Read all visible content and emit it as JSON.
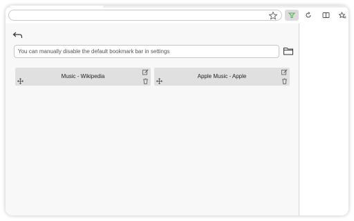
{
  "browser": {
    "address_value": "",
    "toolbar_icons": [
      "star-icon",
      "extension-icon",
      "refresh-icon",
      "split-screen-icon",
      "favorites-icon"
    ],
    "colors": {
      "extension_accent": "#4caf50"
    }
  },
  "panel": {
    "notice_text": "You can manually disable the default bookmark bar in settings",
    "bookmarks": [
      {
        "title": "Music - Wikipedia"
      },
      {
        "title": "Apple Music - Apple"
      }
    ]
  }
}
